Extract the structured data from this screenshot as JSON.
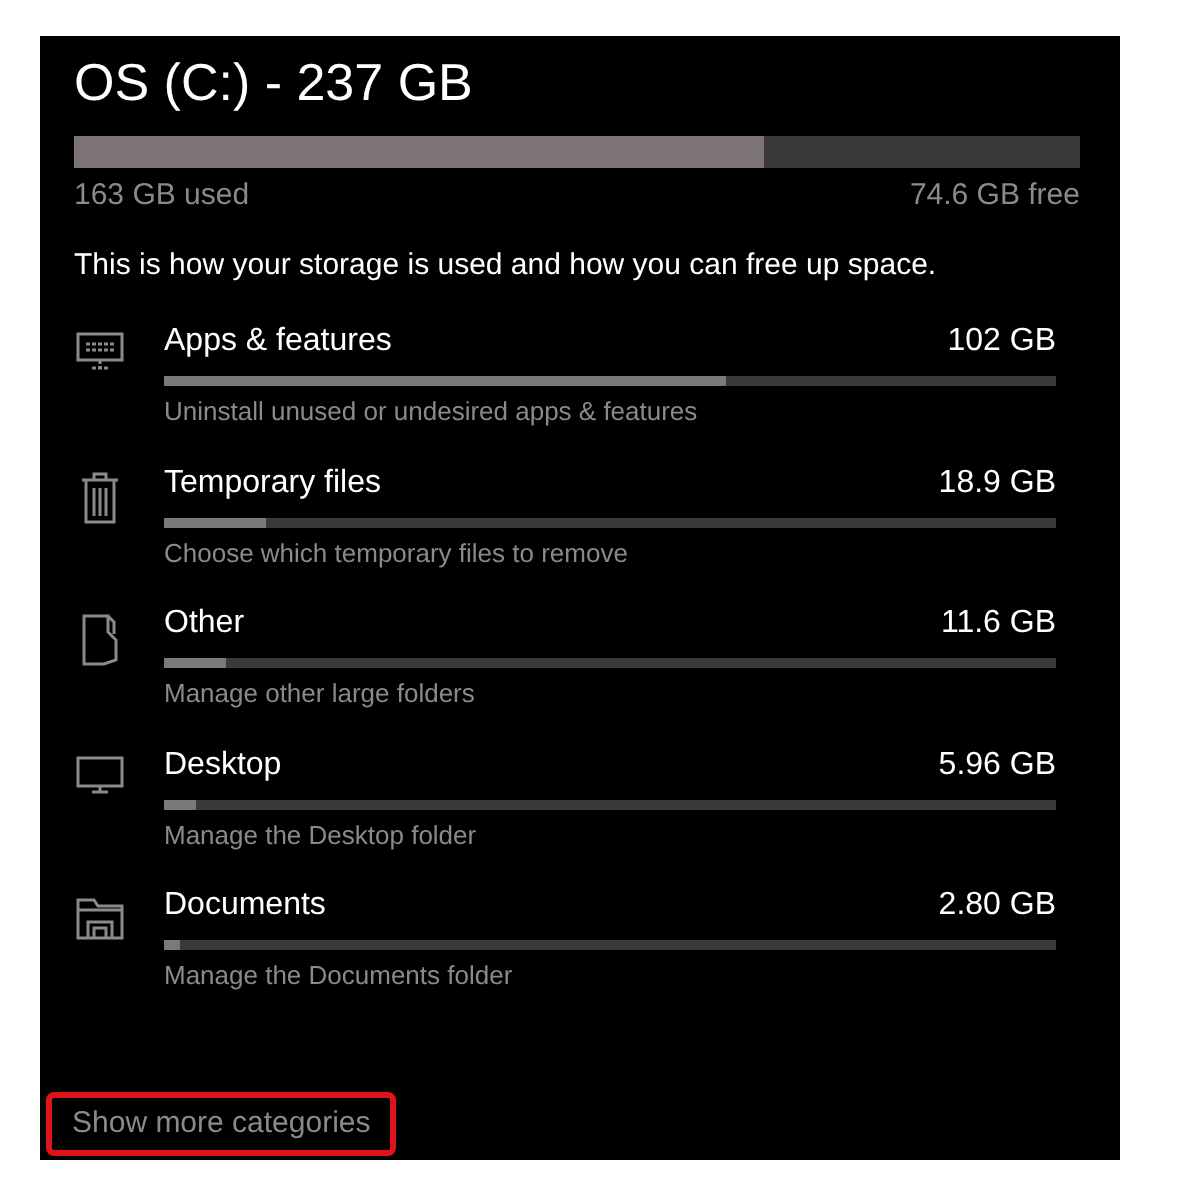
{
  "drive": {
    "title": "OS (C:) - 237 GB",
    "level": 0.686,
    "used": "163 GB used",
    "free": "74.6 GB free"
  },
  "intro": "This is how your storage is used and how you can free up space.",
  "categories": [
    {
      "kind": "apps",
      "name": "Apps & features",
      "size": "102 GB",
      "level": 0.63,
      "description": "Uninstall unused or undesired apps & features"
    },
    {
      "kind": "temp",
      "name": "Temporary files",
      "size": "18.9 GB",
      "level": 0.115,
      "description": "Choose which temporary files to remove"
    },
    {
      "kind": "other",
      "name": "Other",
      "size": "11.6 GB",
      "level": 0.07,
      "description": "Manage other large folders"
    },
    {
      "kind": "desktop",
      "name": "Desktop",
      "size": "5.96 GB",
      "level": 0.036,
      "description": "Manage the Desktop folder"
    },
    {
      "kind": "documents",
      "name": "Documents",
      "size": "2.80 GB",
      "level": 0.018,
      "description": "Manage the Documents folder"
    }
  ],
  "show_more": {
    "label": "Show more categories",
    "highlighted": true
  }
}
